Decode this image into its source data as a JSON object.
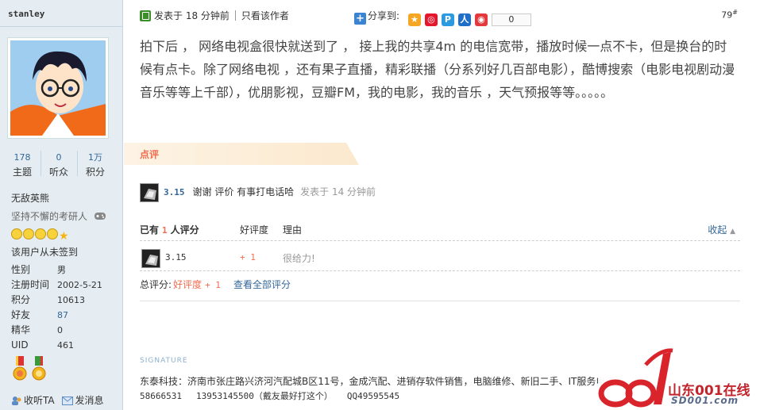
{
  "profile": {
    "username": "stanley",
    "stats": [
      {
        "value": "178",
        "label": "主题"
      },
      {
        "value": "0",
        "label": "听众"
      },
      {
        "value": "1万",
        "label": "积分"
      }
    ],
    "rank_title": "无敌英熊",
    "custom_title": "坚持不懈的考研人",
    "signin_status": "该用户从未签到",
    "fields": [
      {
        "key": "性别",
        "value": "男"
      },
      {
        "key": "注册时间",
        "value": "2002-5-21"
      },
      {
        "key": "积分",
        "value": "10613"
      },
      {
        "key": "好友",
        "value": "87"
      },
      {
        "key": "精华",
        "value": "0"
      },
      {
        "key": "UID",
        "value": "461"
      }
    ],
    "actions": {
      "follow": "收听TA",
      "message": "发消息"
    }
  },
  "post": {
    "posted_label": "发表于 18 分钟前",
    "only_author": "只看该作者",
    "share_label": "分享到:",
    "share_count": "0",
    "floor": "79",
    "floor_sup": "#",
    "content": "拍下后 ， 网络电视盒很快就送到了 ， 接上我的共享4m 的电信宽带，播放时候一点不卡，但是换台的时候有点卡。除了网络电视 ，还有果子直播，精彩联播（分系列好几百部电影），酷博搜索（电影电视剧动漫音乐等等上千部），优朋影视，豆瓣FM，我的电影，我的音乐 ，天气预报等等。。。。。"
  },
  "comments": {
    "section_label": "点评",
    "items": [
      {
        "user": "3.15",
        "text": "谢谢 评价 有事打电话哈",
        "time": "发表于 14 分钟前"
      }
    ]
  },
  "rating": {
    "head_prefix": "已有",
    "head_count": "1",
    "head_suffix": "人评分",
    "col_score": "好评度",
    "col_reason": "理由",
    "collapse": "收起",
    "rows": [
      {
        "user": "3.15",
        "score": "+ 1",
        "reason": "很给力!"
      }
    ],
    "total_label": "总评分:",
    "total_type": "好评度",
    "total_value": "+ 1",
    "view_all": "查看全部评分"
  },
  "signature": {
    "label": "SIGNATURE",
    "line1": "东泰科技：济南市张庄路兴济河汽配城B区11号，金成汽配、进销存软件销售，电脑维修、新旧二手、IT服务电话：0531-",
    "phones": [
      "58666531",
      "13953145500（戴友最好打这个）",
      "QQ49595545"
    ]
  },
  "watermark": {
    "cn": "山东001在线",
    "en": "SD001.com"
  },
  "colors": {
    "sidebar_bg": "#e5edf2",
    "link": "#336699",
    "accent": "#f26c4f"
  }
}
